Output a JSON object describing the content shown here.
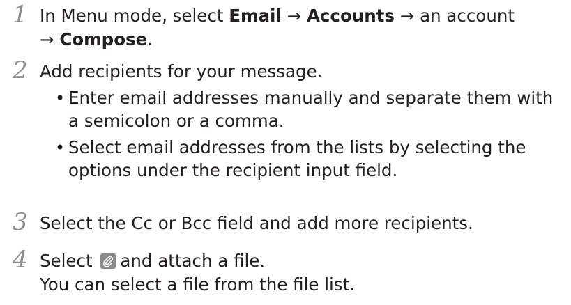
{
  "header_fragment": "",
  "steps": [
    {
      "number": "1",
      "line1": {
        "t1": "In Menu mode, select ",
        "b1": "Email",
        "t2": " → ",
        "b2": "Accounts",
        "t3": " → an account"
      },
      "line2": {
        "t1": "→ ",
        "b1": "Compose",
        "t2": "."
      }
    },
    {
      "number": "2",
      "text": "Add recipients for your message.",
      "bullets": [
        {
          "line1": "Enter email addresses manually and separate them with",
          "line2": "a semicolon or a comma."
        },
        {
          "line1": "Select email addresses from the lists by selecting the",
          "line2": "options under the recipient input field."
        }
      ]
    },
    {
      "number": "3",
      "text": "Select the Cc or Bcc field and add more recipients."
    },
    {
      "number": "4",
      "line1": {
        "before": "Select ",
        "icon": "paperclip-icon",
        "after": "and attach a file."
      },
      "line2": "You can select a file from the file list."
    }
  ],
  "colors": {
    "text": "#231f20",
    "step_number": "#8c8c8c",
    "icon_bg": "#8a8a8a"
  }
}
